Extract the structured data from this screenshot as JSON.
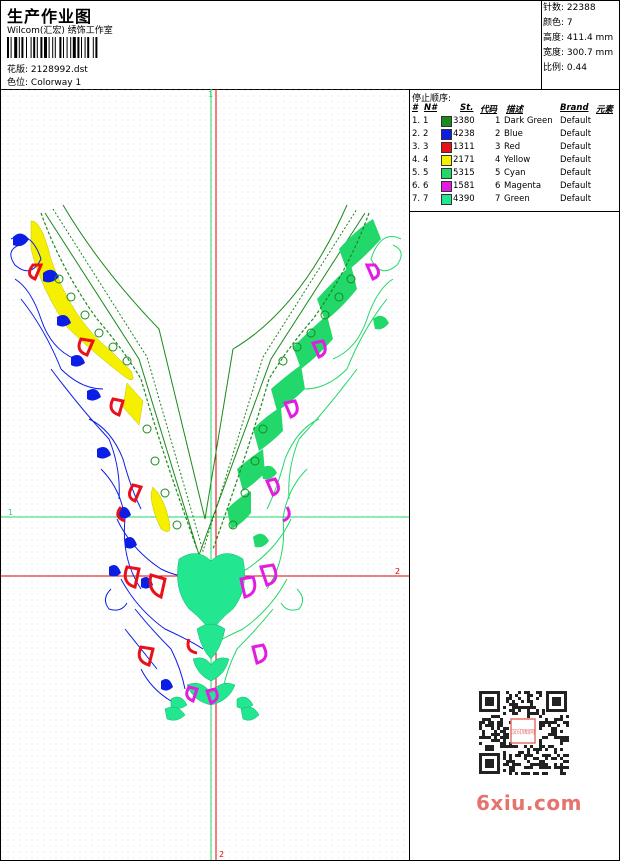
{
  "header": {
    "title": "生产作业图",
    "company": "Wilcom(汇宏) 绣饰工作室",
    "design_label": "花版:",
    "design_value": "2128992.dst",
    "color_label": "色位:",
    "color_value": "Colorway 1"
  },
  "stats": [
    {
      "label": "针数:",
      "value": "22388"
    },
    {
      "label": "颜色:",
      "value": "7"
    },
    {
      "label": "高度:",
      "value": "411.4 mm"
    },
    {
      "label": "宽度:",
      "value": "300.7 mm"
    },
    {
      "label": "比例:",
      "value": "0.44"
    }
  ],
  "stop_sequence": {
    "title": "停止顺序:",
    "headers": {
      "num": "#",
      "n": "N#",
      "st": "St.",
      "code": "代码",
      "desc": "描述",
      "brand": "Brand",
      "elem": "元素"
    },
    "rows": [
      {
        "num": "1.",
        "n": "1",
        "st": "3380",
        "code": "1",
        "desc": "Dark Green",
        "brand": "Default",
        "color": "#1a8a1a"
      },
      {
        "num": "2.",
        "n": "2",
        "st": "4238",
        "code": "2",
        "desc": "Blue",
        "brand": "Default",
        "color": "#0c1ee6"
      },
      {
        "num": "3.",
        "n": "3",
        "st": "1311",
        "code": "3",
        "desc": "Red",
        "brand": "Default",
        "color": "#e8101a"
      },
      {
        "num": "4.",
        "n": "4",
        "st": "2171",
        "code": "4",
        "desc": "Yellow",
        "brand": "Default",
        "color": "#f4f000"
      },
      {
        "num": "5.",
        "n": "5",
        "st": "5315",
        "code": "5",
        "desc": "Cyan",
        "brand": "Default",
        "color": "#22d86a"
      },
      {
        "num": "6.",
        "n": "6",
        "st": "1581",
        "code": "6",
        "desc": "Magenta",
        "brand": "Default",
        "color": "#e21ce0"
      },
      {
        "num": "7.",
        "n": "7",
        "st": "4390",
        "code": "7",
        "desc": "Green",
        "brand": "Default",
        "color": "#22e690"
      }
    ]
  },
  "design_area": {
    "guide_labels": {
      "v1": "1",
      "v2": "2",
      "h1": "1",
      "h2": "2"
    },
    "guide_colors": {
      "green": "#22d86a",
      "red": "#e00000"
    }
  },
  "watermark": {
    "text": "6xiu.com",
    "qr_center_text": "汉印图网"
  }
}
